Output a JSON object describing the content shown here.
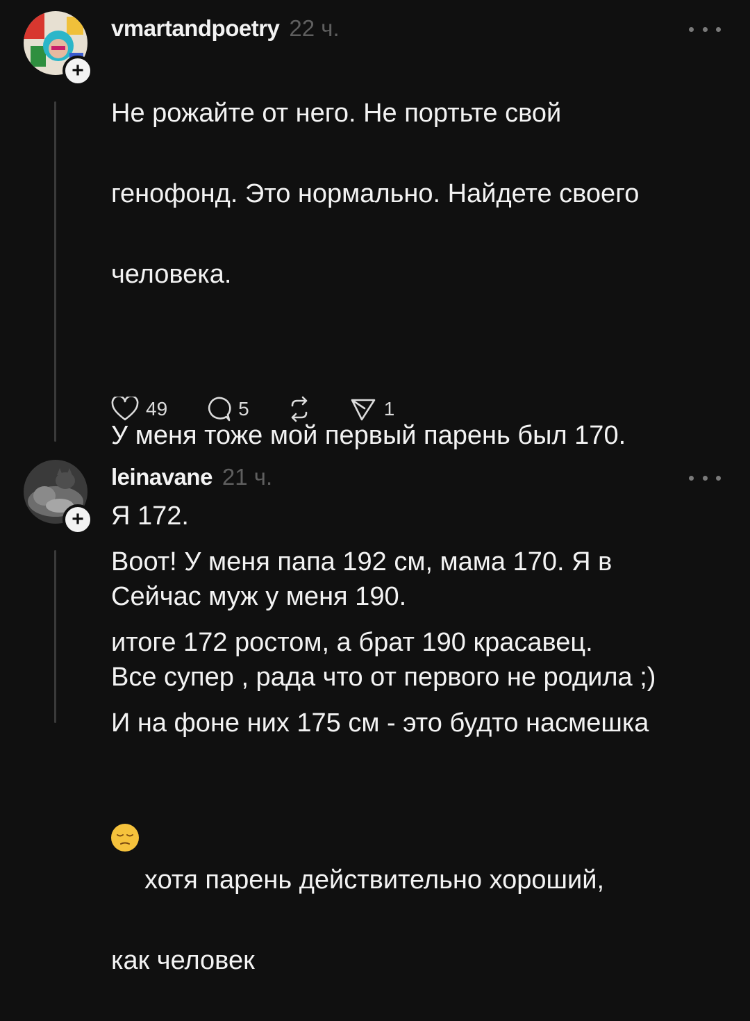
{
  "posts": [
    {
      "username": "vmartandpoetry",
      "time": "22 ч.",
      "lines": [
        "Не рожайте от него. Не портьте свой",
        "генофонд. Это нормально. Найдете своего",
        "человека.",
        "",
        "У меня тоже мой первый парень был 170.",
        "Я 172.",
        "Сейчас муж у меня 190.",
        "Все супер , рада что от первого не родила ;)"
      ],
      "likes": "49",
      "comments": "5",
      "shares": "1"
    },
    {
      "username": "leinavane",
      "time": "21 ч.",
      "lines": [
        "Воот! У меня папа 192 см, мама 170. Я в",
        "итоге 172 ростом, а брат 190 красавец.",
        "И на фоне них 175 см - это будто насмешка",
        "хотя парень действительно хороший,",
        "как человек"
      ]
    }
  ],
  "icons": {
    "like": "heart-icon",
    "comment": "comment-bubble-icon",
    "repost": "repost-icon",
    "share": "send-icon",
    "more": "more-dots-icon",
    "follow": "plus-icon",
    "emoji": "pensive-face-emoji"
  },
  "colors": {
    "background": "#101010",
    "text": "#f3f3f3",
    "muted": "#5f5f5f",
    "thread_line": "#3a3a3a"
  }
}
